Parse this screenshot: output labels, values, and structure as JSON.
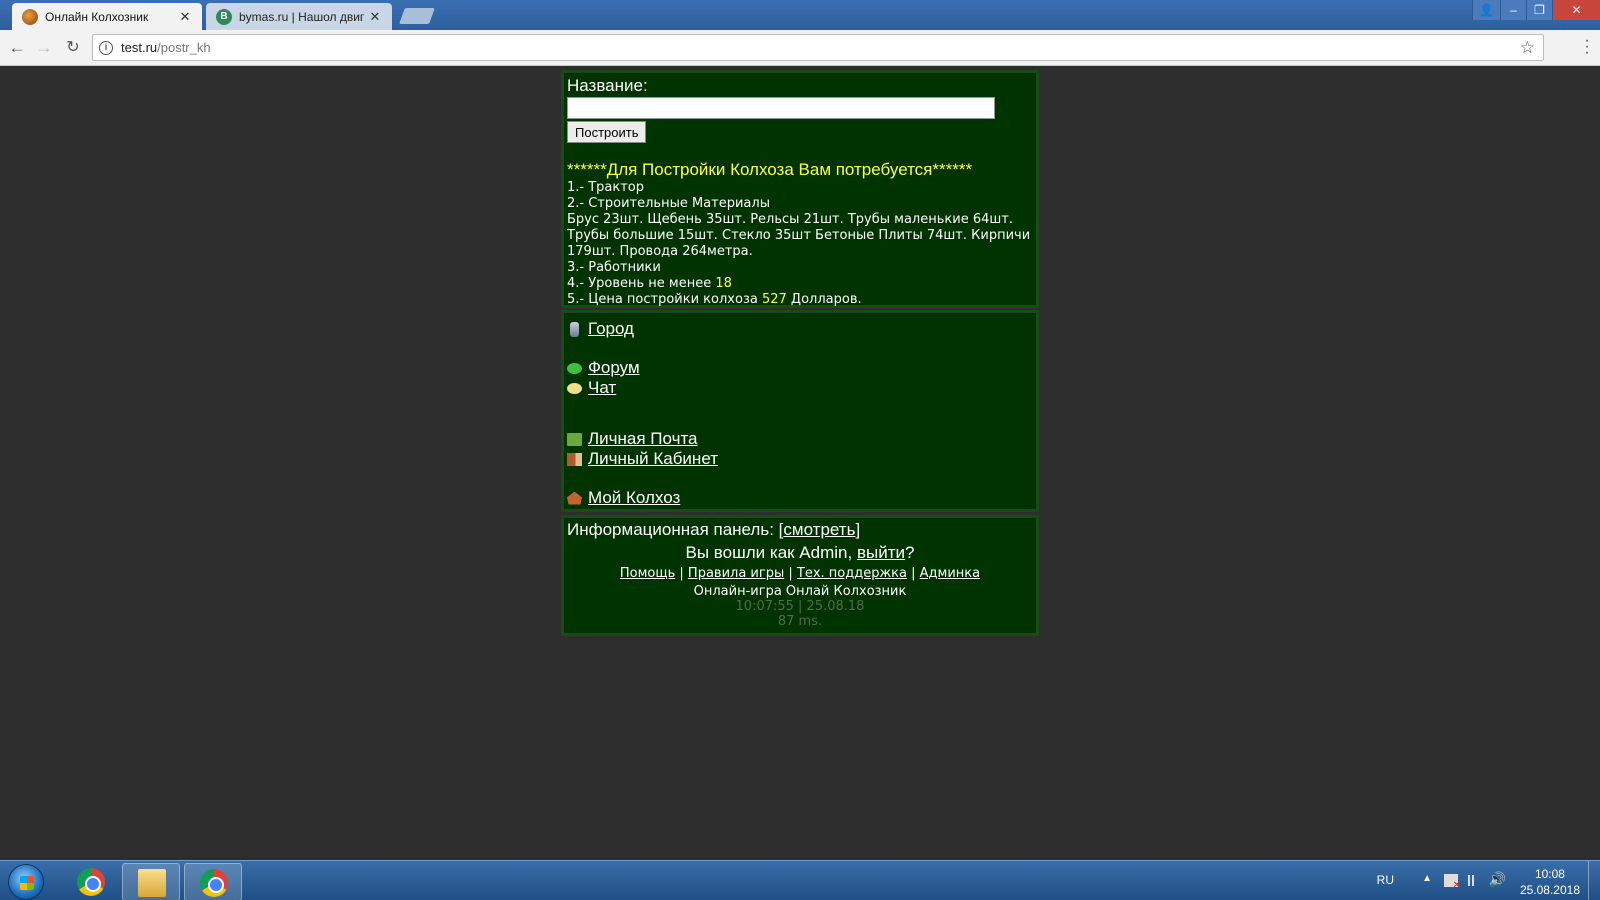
{
  "browser": {
    "tabs": [
      {
        "title": "Онлайн Колхозник",
        "active": true
      },
      {
        "title": "bymas.ru | Нашол двиг ...",
        "favicon_letter": "B",
        "active": false
      }
    ],
    "url_host": "test.ru",
    "url_path": "/postr_kh"
  },
  "build_form": {
    "name_label": "Название:",
    "name_value": "",
    "build_button": "Построить"
  },
  "requirements": {
    "title": "******Для Постройки Колхоза Вам потребуется******",
    "item1": "1.- Трактор",
    "item2": "2.- Строительные Материалы",
    "materials": "Брус 23шт. Щебень 35шт. Рельсы 21шт. Трубы маленькие 64шт. Трубы большие 15шт. Стекло 35шт Бетоные Плиты 74шт. Кирпичи 179шт. Провода 264метра.",
    "item3": "3.- Работники",
    "item4_prefix": "4.- Уровень не менее ",
    "item4_level": "18",
    "item5_prefix": "5.- Цена постройки колхоза ",
    "item5_price": "527",
    "item5_suffix": " Долларов."
  },
  "menu": {
    "city": "Город",
    "forum": "Форум",
    "chat": "Чат",
    "mail": "Личная Почта",
    "cabinet": "Личный Кабинет",
    "kolhoz": "Мой Колхоз"
  },
  "footer": {
    "info_label": "Информационная панель: [",
    "info_link": "смотреть",
    "info_close": "]",
    "login_prefix": "Вы вошли как Admin, ",
    "logout_link": "выйти",
    "login_suffix": "?",
    "links": [
      "Помощь",
      "Правила игры",
      "Тех. поддержка",
      "Админка"
    ],
    "separator": " | ",
    "site_name": "Онлайн-игра Онлай Колхозник",
    "time": "10:07:55 | 25.08.18",
    "load": "87 ms."
  },
  "taskbar": {
    "lang": "RU",
    "time": "10:08",
    "date": "25.08.2018"
  }
}
